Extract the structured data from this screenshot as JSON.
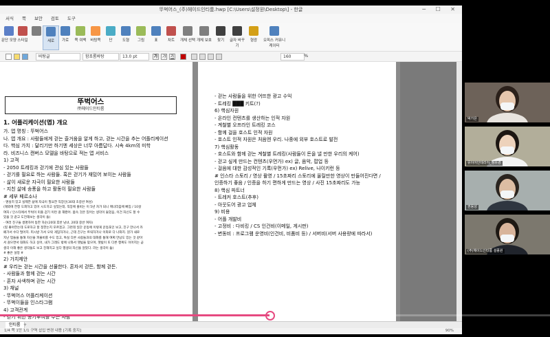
{
  "window": {
    "title": "뚜벅어스_(주)헤이드인티룸.hwp [C:\\Users\\설정원\\Desktop\\] - 한글",
    "controls": "─ ☐ ✕"
  },
  "menu": [
    "서식",
    "쪽",
    "보안",
    "검토",
    "도구"
  ],
  "ribbon": [
    {
      "label": "문단 모양",
      "icon": "paragraph-icon",
      "color": "#5b7fc7"
    },
    {
      "label": "스타일",
      "icon": "style-icon",
      "color": "#c0504d"
    },
    {
      "label": "",
      "icon": "list-icon",
      "color": "#7f7f7f"
    },
    {
      "label": "세로",
      "icon": "vertical-icon",
      "color": "#4f81bd"
    },
    {
      "label": "가로",
      "icon": "horizontal-icon",
      "color": "#4f81bd"
    },
    {
      "label": "쪽 여백",
      "icon": "margin-icon",
      "color": "#9bbb59"
    },
    {
      "label": "바탕쪽",
      "icon": "master-page-icon",
      "color": "#f79646"
    },
    {
      "label": "단",
      "icon": "column-icon",
      "color": "#4bacc6"
    },
    {
      "label": "도형",
      "icon": "shape-icon",
      "color": "#4f81bd"
    },
    {
      "label": "그림",
      "icon": "picture-icon",
      "color": "#9bbb59"
    },
    {
      "label": "표",
      "icon": "table-icon",
      "color": "#4f81bd"
    },
    {
      "label": "차트",
      "icon": "chart-icon",
      "color": "#c0504d"
    },
    {
      "label": "개체 선택",
      "icon": "select-icon",
      "color": "#7f7f7f"
    },
    {
      "label": "개체 보호",
      "icon": "protect-icon",
      "color": "#7f7f7f"
    },
    {
      "label": "찾기",
      "icon": "find-icon",
      "color": "#404040"
    },
    {
      "label": "글자 바꾸기",
      "icon": "replace-icon",
      "color": "#404040"
    },
    {
      "label": "형광",
      "icon": "highlight-icon",
      "color": "#d4a017"
    },
    {
      "label": "오피스 커뮤니케이터",
      "icon": "messenger-icon",
      "color": "#4f81bd"
    }
  ],
  "format_bar": {
    "style": "바탕글",
    "font": "함초롬바탕",
    "size": "13.0 pt",
    "zoom": "160"
  },
  "page1": {
    "title": "뚜벅어스",
    "subtitle": "㈜헤이드인티룸",
    "lines": [
      {
        "t": "1. 어플리케이션(앱) 개요",
        "h": 1
      },
      {
        "t": "가. 앱 명칭 : 뚜벅어스"
      },
      {
        "t": "나. 앱 개요 : 사람들에게 걷는 즐거움을 알게 하고, 걷는 시간을 추는 어플리케이션"
      },
      {
        "t": "다. 핵심 가치 : 달리기만 하기엔 세상은 너무 아름답다. 시속 4km의 미학"
      },
      {
        "t": "라. 비즈니스 캔버스 모델을 바탕으로 적는 앱 서비스"
      },
      {
        "t": "1) 고객"
      },
      {
        "t": "- 2050 트레킹과 걷기에 관심 있는 사람들"
      },
      {
        "t": "- 걷기를 필요로 하는 사람들. 혹은 걷기가 재밌어 보이는 사람들"
      },
      {
        "t": "- 삶이 새로운 자극이 필요한 사람들"
      },
      {
        "t": "- 지친 삶에 송풍을 하고 활동이 필요한 사람들"
      },
      {
        "t": "# 세부 페르소나"
      },
      {
        "t": "- 명실히 있고 실제한 삶에 자극이 필요한 직장인(30대 초중반 여성)",
        "s": 1
      },
      {
        "t": "(해외에 한창 도회하고 있어 시도하고 싶었는데, 직장에 출비는 이 5년 차가 되니 매너리즘에 빠짐 / 10살",
        "s": 1
      },
      {
        "t": "여자 / 인스타에서 뚜벅이 미출 걷기 이런 걸 해봤어. 몸속 것은 있어는 생각이 들었음, 이건 자신도 할 수",
        "s": 1
      },
      {
        "t": "있을 것 같고 도전해보는 생각이 들)",
        "s": 1
      },
      {
        "t": "- 여러 친구들 생명하며 동한 하순(20대 후반 남녀, 20대 중반 여자)",
        "s": 1
      },
      {
        "t": "(힐 좋아한는데 도로하고 할 정한는지 모르겠고. 그런데 일단 운동에 이렇게 운동포인 보고, 친구 만나서 카",
        "s": 1
      },
      {
        "t": "페가서 수다 떨어지. 피시방 가서 오락 게임하거나, 근데 친구는 트릭하거나 이외로 다 나와지. 뭔가 새로",
        "s": 1
      },
      {
        "t": "지난 업들을 통해 자신을 피울비를 수도 있고, 특실 다른 사람들과의 대화를 통해 여쩌 만났도 있는 것 같아",
        "s": 1
      },
      {
        "t": "서 걸으면서 대화도 하고 싶어, 내가 그래도 밖에 나와서 햇빛을 맞으며, 햇빛이 또 다른 행복도 이어지는 곧",
        "s": 1
      },
      {
        "t": "생각 이해 좋은 생각들도 보고 친해지고 싶다 행생의 자신을 알았다. 라는 생각이 듦)",
        "s": 1
      },
      {
        "t": "# 좋은 설정 #",
        "s": 1
      },
      {
        "t": "2) 가치제안"
      },
      {
        "t": "# 우리는 걷는 시간을 선물한다. 혼자서 걷든, 함께 걷든."
      },
      {
        "t": "- 사람들과 함께 걷는 시간"
      },
      {
        "t": "- 혼자 사색하며 걷는 시간"
      },
      {
        "t": "3) 채널"
      },
      {
        "t": "- 뚜벅어스 어플리케이션"
      },
      {
        "t": "- 뚜벅이들을 인스타그램"
      },
      {
        "t": "4) 고객관계"
      },
      {
        "t": "- 걷기 위한 동기부여를 주는 사람"
      }
    ]
  },
  "page2": {
    "lines": [
      {
        "t": "- 걷는 사람들을 위한 어뜨한 광고 수익"
      },
      {
        "t": "- 트레킹 ███ 키트(?)"
      },
      {
        "t": "6) 핵심자원"
      },
      {
        "t": "- 온라인 컨텐츠를 생산하는 인적 자원"
      },
      {
        "t": "- 계철별 오프라인 트레킹 코스"
      },
      {
        "t": "- 함께 걸을 호스트 인적 자원"
      },
      {
        "t": "- 호스트 인적 자원은 처음엔 우리. 나중에 외부 호스트로 발전"
      },
      {
        "t": "7) 핵심활동"
      },
      {
        "t": "- 호스트와 함께 걷는 계철별 트레킹(사람들이 돈을 낼 만한 우리의 케어)"
      },
      {
        "t": "- 걷고 싶게 만드는 컨텐츠(우먼가) ex) 글, 음악, 팝업 등"
      },
      {
        "t": "- 걸음에 대한 감성적인 기록(우먼가) ex) Relive, 나이키런 등"
      },
      {
        "t": "# 인스타 스토리 / 영상 촬영 / 15초짜리 스토리에 올릴만한 영상이 만들어진다면 /"
      },
      {
        "t": "인증하기 좋음 / 인증을 하기 편하게 만드는 영상 / 사진 15초짜리도 가능"
      },
      {
        "t": "8) 핵심 파트너"
      },
      {
        "t": "- 트레커 호스트(추후)"
      },
      {
        "t": "- 아웃도어 광고 업체"
      },
      {
        "t": "9) 비용"
      },
      {
        "t": "- 어플 개발비"
      },
      {
        "t": "- 고정비 : 다비킹 / CS 인건비(이메일, 게시판)"
      },
      {
        "t": "- 변동비 : 프로그램 운영비(인건비, 비품비 등) / 서버비(서버 사용량에 따라서)"
      }
    ]
  },
  "tabs": {
    "active": "인티룸",
    "add": "+"
  },
  "status": {
    "text": "1/4 쪽    1단    1/1 구역    삽입    변경 내용 [기록 중지]",
    "zoom": "90%"
  },
  "video": {
    "progress": 0.49,
    "color": "#e64980"
  },
  "participants": [
    {
      "name": "박가은",
      "bg": "#6d6259",
      "face": "#e5c6ad",
      "hair": "#2b201a",
      "shirt": "#e8e4df"
    },
    {
      "name": "뮤이어인테리어_정유경",
      "bg": "#b2ae9a",
      "face": "#edd2bb",
      "hair": "#1c1612",
      "shirt": "#f3f3f3"
    },
    {
      "name": "권용성",
      "bg": "#a7afae",
      "face": "#dcbda3",
      "hair": "#2a241f",
      "shirt": "#2f3640"
    },
    {
      "name": "(주)헤이드인티룸 설종원",
      "bg": "#7c786e",
      "face": "#d8b49b",
      "hair": "#1d1813",
      "shirt": "#20242c"
    }
  ]
}
